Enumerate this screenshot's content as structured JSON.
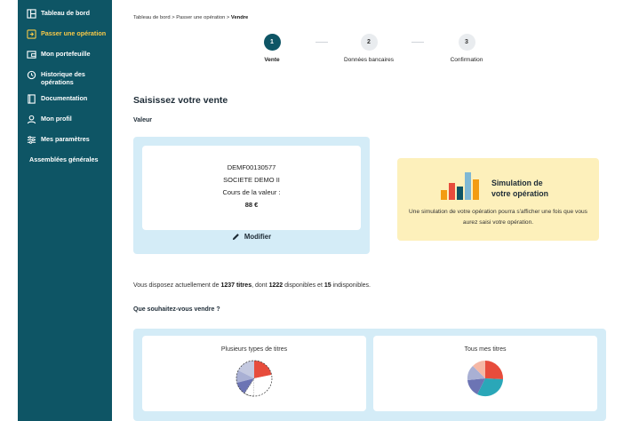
{
  "sidebar": {
    "items": [
      {
        "label": "Tableau de bord",
        "icon": "dashboard-icon",
        "active": false
      },
      {
        "label": "Passer une opération",
        "icon": "order-icon",
        "active": true
      },
      {
        "label": "Mon portefeuille",
        "icon": "wallet-icon",
        "active": false
      },
      {
        "label": "Historique des opérations",
        "icon": "history-icon",
        "active": false
      },
      {
        "label": "Documentation",
        "icon": "book-icon",
        "active": false
      },
      {
        "label": "Mon profil",
        "icon": "user-icon",
        "active": false
      },
      {
        "label": "Mes paramètres",
        "icon": "settings-icon",
        "active": false
      },
      {
        "label": "Assemblées générales",
        "icon": "",
        "active": false
      }
    ]
  },
  "breadcrumb": {
    "part1": "Tableau de bord",
    "sep": " > ",
    "part2": "Passer une opération",
    "current": "Vendre"
  },
  "stepper": {
    "steps": [
      {
        "number": "1",
        "label": "Vente",
        "active": true
      },
      {
        "number": "2",
        "label": "Données bancaires",
        "active": false
      },
      {
        "number": "3",
        "label": "Confirmation",
        "active": false
      }
    ]
  },
  "form": {
    "title": "Saisissez votre vente",
    "valeur_label": "Valeur",
    "valeur": {
      "code": "DEMF00130577",
      "name": "SOCIETE DEMO II",
      "price_label": "Cours de la valeur :",
      "price": "88 €"
    },
    "modify_label": "Modifier"
  },
  "simulation": {
    "title_line1": "Simulation de",
    "title_line2": "votre opération",
    "description": "Une simulation de votre opération pourra s'afficher une fois que vous aurez saisi votre opération.",
    "bar_colors": [
      "#f39c12",
      "#e74c3c",
      "#0e5565",
      "#7fb8d4"
    ]
  },
  "holdings": {
    "prefix": "Vous disposez actuellement de ",
    "total": "1237 titres",
    "middle": ", dont ",
    "available": "1222",
    "middle2": " disponibles et ",
    "unavailable": "15",
    "suffix": " indisponibles."
  },
  "sell_question": "Que souhaitez-vous vendre ?",
  "choices": [
    {
      "label": "Plusieurs types de titres"
    },
    {
      "label": "Tous mes titres"
    }
  ],
  "colors": {
    "sidebar_bg": "#0e5565",
    "accent": "#f7c948",
    "panel_bg": "#d4ecf7",
    "sim_bg": "#fdf0bb"
  }
}
